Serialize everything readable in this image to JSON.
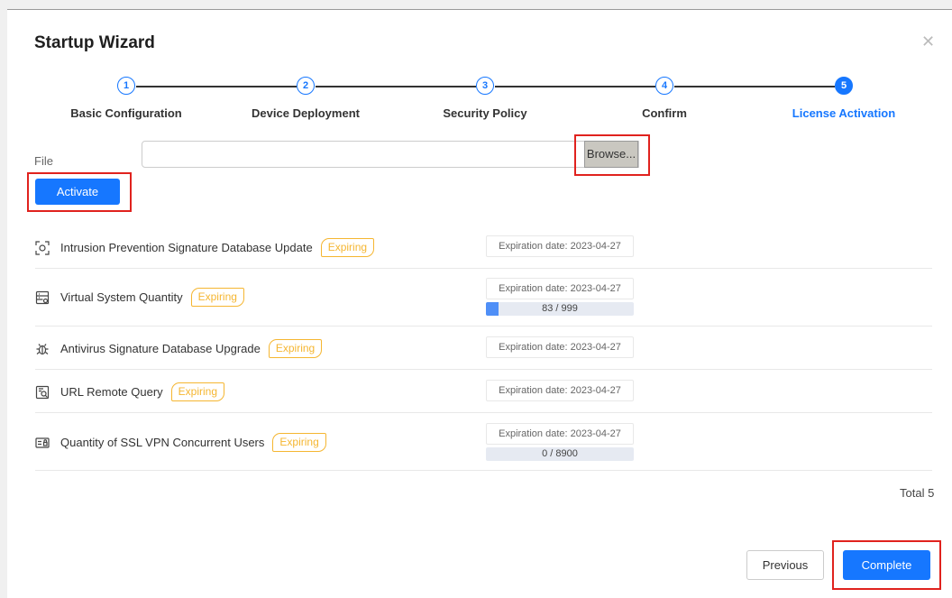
{
  "dialog": {
    "title": "Startup Wizard",
    "close_icon": "close-icon"
  },
  "steps": [
    {
      "number": "1",
      "label": "Basic Configuration",
      "active": false
    },
    {
      "number": "2",
      "label": "Device Deployment",
      "active": false
    },
    {
      "number": "3",
      "label": "Security Policy",
      "active": false
    },
    {
      "number": "4",
      "label": "Confirm",
      "active": false
    },
    {
      "number": "5",
      "label": "License Activation",
      "active": true
    }
  ],
  "file": {
    "label": "File",
    "value": "",
    "placeholder": "",
    "browse_label": "Browse...",
    "activate_label": "Activate"
  },
  "licenses": [
    {
      "name": "Intrusion Prevention Signature Database Update",
      "icon": "signature-scan-icon",
      "badge": "Expiring",
      "expiration": "Expiration date: 2023-04-27"
    },
    {
      "name": "Virtual System Quantity",
      "icon": "virtual-system-icon",
      "badge": "Expiring",
      "expiration": "Expiration date: 2023-04-27",
      "quota": {
        "text": "83 / 999",
        "used": 83,
        "total": 999
      }
    },
    {
      "name": "Antivirus Signature Database Upgrade",
      "icon": "bug-icon",
      "badge": "Expiring",
      "expiration": "Expiration date: 2023-04-27"
    },
    {
      "name": "URL Remote Query",
      "icon": "url-query-icon",
      "badge": "Expiring",
      "expiration": "Expiration date: 2023-04-27"
    },
    {
      "name": "Quantity of SSL VPN Concurrent Users",
      "icon": "ssl-vpn-icon",
      "badge": "Expiring",
      "expiration": "Expiration date: 2023-04-27",
      "quota": {
        "text": "0 / 8900",
        "used": 0,
        "total": 8900
      }
    }
  ],
  "footer": {
    "total": "Total 5",
    "previous_label": "Previous",
    "complete_label": "Complete"
  },
  "colors": {
    "primary": "#1677ff",
    "expiring": "#f5b631",
    "highlight": "#e0221e"
  }
}
